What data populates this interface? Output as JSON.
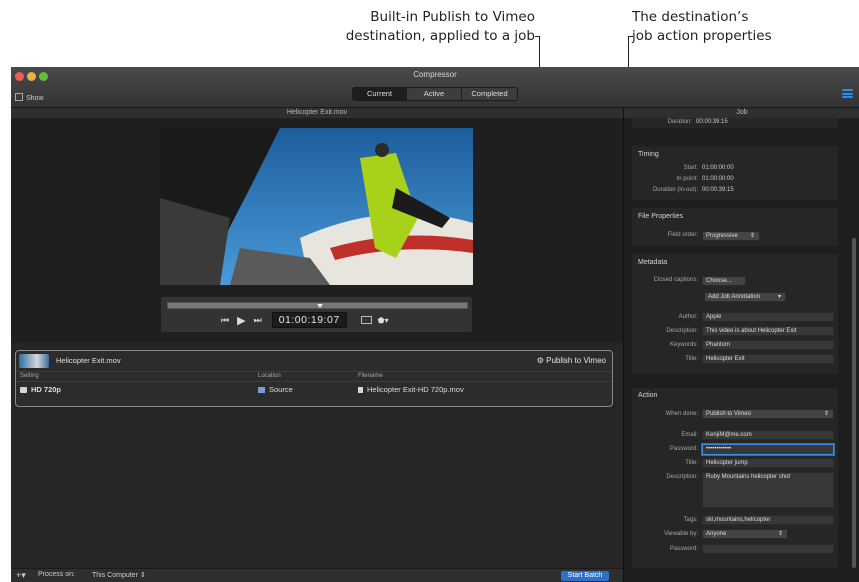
{
  "callouts": {
    "left_line1": "Built-in Publish to Vimeo",
    "left_line2": "destination, applied to a job",
    "right_line1": "The destination’s",
    "right_line2": "job action properties"
  },
  "window": {
    "title": "Compressor",
    "show_label": "Show",
    "tabs": [
      "Current",
      "Active",
      "Completed"
    ],
    "selected_tab": "Current"
  },
  "viewer": {
    "filename": "Helicopter Exit.mov",
    "timecode": "01:00:19:07"
  },
  "batch": {
    "job_name": "Helicopter Exit.mov",
    "destination_label": "Publish to Vimeo",
    "columns": {
      "setting": "Setting",
      "location": "Location",
      "filename": "Filename"
    },
    "output": {
      "setting": "HD 720p",
      "location": "Source",
      "filename": "Helicopter Exit-HD 720p.mov"
    }
  },
  "bottom": {
    "add": "+",
    "process_label": "Process on:",
    "process_value": "This Computer",
    "start_button": "Start Batch"
  },
  "inspector": {
    "header": "Job",
    "cut_row": {
      "label": "Duration:",
      "value": "00:00:39:15"
    },
    "timing": {
      "title": "Timing",
      "start_label": "Start:",
      "start": "01:00:00:00",
      "in_label": "In point:",
      "in_point": "01:00:00:00",
      "dur_label": "Duration (in-out):",
      "duration": "00:00:39:15"
    },
    "file_props": {
      "title": "File Properties",
      "field_order_label": "Field order:",
      "field_order": "Progressive"
    },
    "metadata": {
      "title": "Metadata",
      "captions_label": "Closed captions:",
      "choose": "Choose...",
      "annotation": "Add Job Annotation",
      "author_label": "Author:",
      "author": "Apple",
      "description_label": "Description:",
      "description": "This video is about Helicopter Exit",
      "keywords_label": "Keywords:",
      "keywords": "Phantom",
      "title_label": "Title:",
      "title_value": "Helicopter Exit"
    },
    "action": {
      "title": "Action",
      "when_done_label": "When done:",
      "when_done": "Publish to Vimeo",
      "email_label": "Email:",
      "email": "KenjiM@me.com",
      "password_label": "Password:",
      "password": "••••••••••••",
      "title_label": "Title:",
      "title_value": "Helicopter jump",
      "description_label": "Description:",
      "description": "Ruby Mountains helicopter shot",
      "tags_label": "Tags:",
      "tags": "ski,mountains,helicopter",
      "viewable_label": "Viewable by:",
      "viewable": "Anyone",
      "password2_label": "Password:"
    }
  },
  "colors": {
    "accent": "#2d70c6",
    "focus": "#3a8ee6",
    "window_bg": "#262626"
  }
}
